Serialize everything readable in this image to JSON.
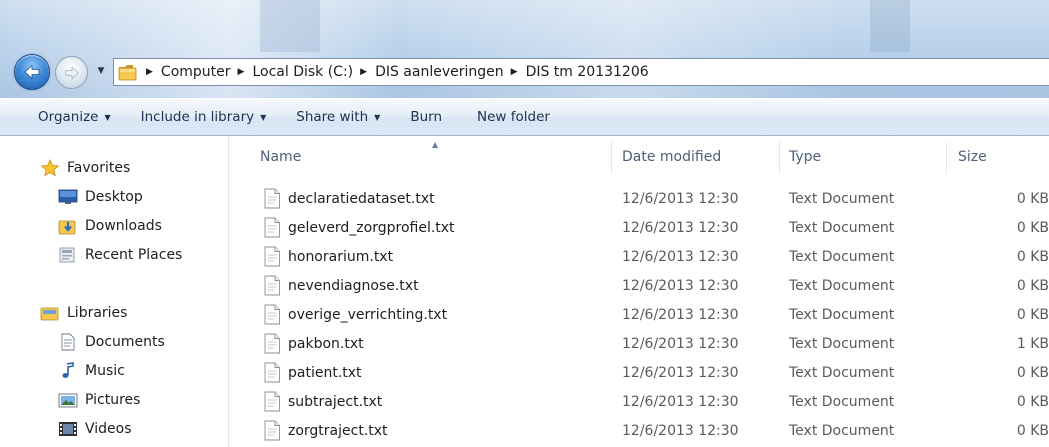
{
  "address": {
    "breadcrumbs": [
      "Computer",
      "Local Disk (C:)",
      "DIS aanleveringen",
      "DIS tm 20131206"
    ]
  },
  "commands": {
    "organize": "Organize",
    "include_in_library": "Include in library",
    "share_with": "Share with",
    "burn": "Burn",
    "new_folder": "New folder"
  },
  "navigation": {
    "favorites": {
      "label": "Favorites",
      "items": [
        "Desktop",
        "Downloads",
        "Recent Places"
      ]
    },
    "libraries": {
      "label": "Libraries",
      "items": [
        "Documents",
        "Music",
        "Pictures",
        "Videos"
      ]
    }
  },
  "columns": {
    "name": "Name",
    "date_modified": "Date modified",
    "type": "Type",
    "size": "Size"
  },
  "files": [
    {
      "name": "declaratiedataset.txt",
      "date": "12/6/2013 12:30",
      "type": "Text Document",
      "size": "0 KB"
    },
    {
      "name": "geleverd_zorgprofiel.txt",
      "date": "12/6/2013 12:30",
      "type": "Text Document",
      "size": "0 KB"
    },
    {
      "name": "honorarium.txt",
      "date": "12/6/2013 12:30",
      "type": "Text Document",
      "size": "0 KB"
    },
    {
      "name": "nevendiagnose.txt",
      "date": "12/6/2013 12:30",
      "type": "Text Document",
      "size": "0 KB"
    },
    {
      "name": "overige_verrichting.txt",
      "date": "12/6/2013 12:30",
      "type": "Text Document",
      "size": "0 KB"
    },
    {
      "name": "pakbon.txt",
      "date": "12/6/2013 12:30",
      "type": "Text Document",
      "size": "1 KB"
    },
    {
      "name": "patient.txt",
      "date": "12/6/2013 12:30",
      "type": "Text Document",
      "size": "0 KB"
    },
    {
      "name": "subtraject.txt",
      "date": "12/6/2013 12:30",
      "type": "Text Document",
      "size": "0 KB"
    },
    {
      "name": "zorgtraject.txt",
      "date": "12/6/2013 12:30",
      "type": "Text Document",
      "size": "0 KB"
    }
  ],
  "icons": {
    "back": "back-arrow-icon",
    "forward": "forward-arrow-icon",
    "folder": "folder-icon",
    "file": "text-file-icon",
    "star": "star-icon"
  },
  "colors": {
    "glass": "#bcd3ec",
    "command_bar": "#dce8f5",
    "command_text": "#1e3150",
    "header_text": "#4c607a",
    "secondary_text": "#5a5a5a",
    "back_button": "#3f8bd8"
  }
}
